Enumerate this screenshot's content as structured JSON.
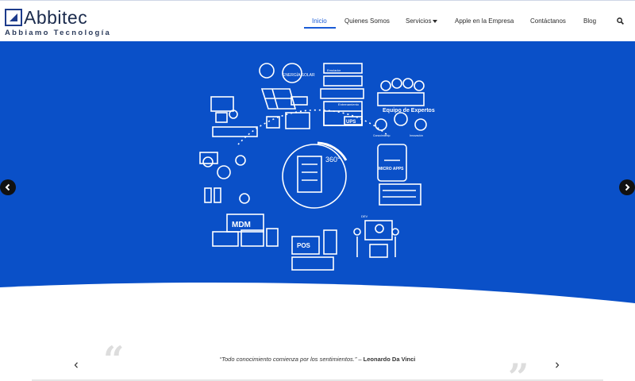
{
  "brand": {
    "name": "Abbitec",
    "tagline": "Abbiamo Tecnología",
    "color": "#1d3b8b"
  },
  "nav": {
    "items": [
      {
        "label": "Inicio",
        "active": true
      },
      {
        "label": "Quienes Somos"
      },
      {
        "label": "Servicios",
        "has_dropdown": true
      },
      {
        "label": "Apple en la Empresa"
      },
      {
        "label": "Contáctanos"
      },
      {
        "label": "Blog"
      }
    ],
    "search_icon": "search-icon",
    "accent": "#1a5bd6"
  },
  "hero": {
    "background": "#0a50c8",
    "labels": {
      "solar": "ENERGÍA SOLAR",
      "ups": "UPS",
      "experts": "Equipo de Expertos",
      "knowledge": "Conocimiento",
      "innovation": "Innovación",
      "center": "360°",
      "micro_apps": "MICRO APPS",
      "mdm": "MDM",
      "pos": "POS",
      "training": "Entrenamiento",
      "emulator": "Emulador",
      "dev": "DEV"
    },
    "prev_icon": "chevron-left-icon",
    "next_icon": "chevron-right-icon"
  },
  "testimonial": {
    "quote": "“Todo conocimiento comienza por los sentimientos.”",
    "separator": " – ",
    "author": "Leonardo Da Vinci"
  }
}
